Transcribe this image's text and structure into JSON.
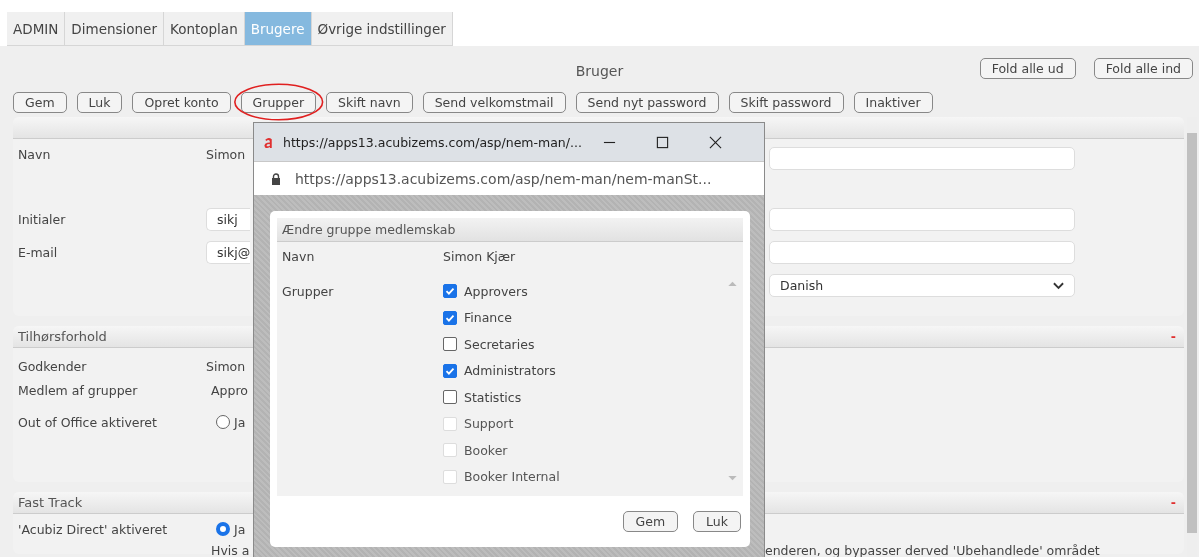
{
  "tabs": [
    {
      "label": "ADMIN",
      "selected": false
    },
    {
      "label": "Dimensioner",
      "selected": false
    },
    {
      "label": "Kontoplan",
      "selected": false
    },
    {
      "label": "Brugere",
      "selected": true
    },
    {
      "label": "Øvrige indstillinger",
      "selected": false
    }
  ],
  "page_title": "Bruger",
  "fold_buttons": [
    "Fold alle ud",
    "Fold alle ind"
  ],
  "toolbar_buttons": [
    {
      "label": "Gem",
      "highlighted": false
    },
    {
      "label": "Luk",
      "highlighted": false
    },
    {
      "label": "Opret konto",
      "highlighted": false
    },
    {
      "label": "Grupper",
      "highlighted": true
    },
    {
      "label": "Skift navn",
      "highlighted": false
    },
    {
      "label": "Send velkomstmail",
      "highlighted": false
    },
    {
      "label": "Send nyt password",
      "highlighted": false
    },
    {
      "label": "Skift password",
      "highlighted": false
    },
    {
      "label": "Inaktiver",
      "highlighted": false
    }
  ],
  "sections": [
    {
      "rows": [
        {
          "label": "Navn",
          "value": {
            "kind": "text",
            "text": "Simon"
          },
          "right": {
            "kind": "input"
          }
        },
        {
          "label": "Initialer",
          "value": {
            "kind": "input",
            "text": "sikj"
          },
          "right": {
            "kind": "input"
          }
        },
        {
          "label": "E-mail",
          "value": {
            "kind": "input",
            "text": "sikj@"
          },
          "right": {
            "kind": "input"
          }
        },
        {
          "right": {
            "kind": "select",
            "text": "Danish"
          }
        }
      ]
    },
    {
      "title": "Tilhørsforhold",
      "collapse": "-",
      "rows": [
        {
          "label": "Godkender",
          "value": {
            "kind": "text",
            "text": "Simon"
          }
        },
        {
          "label": "Medlem af grupper",
          "value": {
            "kind": "text",
            "text": "Appro"
          }
        },
        {
          "label": "Out of Office aktiveret",
          "value": {
            "kind": "radio",
            "text": "Ja",
            "selected": false
          }
        }
      ]
    },
    {
      "title": "Fast Track",
      "collapse": "-",
      "rows": [
        {
          "label": "'Acubiz Direct' aktiveret",
          "value": {
            "kind": "radio",
            "text": "Ja",
            "selected": true
          }
        }
      ],
      "note": [
        "Hvis a",
        "enderen, og bypasser derved 'Ubehandlede' området"
      ]
    }
  ],
  "popup": {
    "title": "https://apps13.acubizems.com/asp/nem-man/...",
    "address": "https://apps13.acubizems.com/asp/nem-man/nem-manSt...",
    "dialog": {
      "title": "Ændre gruppe medlemskab",
      "name_label": "Navn",
      "name_value": "Simon Kjær",
      "groups_label": "Grupper",
      "groups": [
        {
          "label": "Approvers",
          "checked": true,
          "disabled": false
        },
        {
          "label": "Finance",
          "checked": true,
          "disabled": false
        },
        {
          "label": "Secretaries",
          "checked": false,
          "disabled": false
        },
        {
          "label": "Administrators",
          "checked": true,
          "disabled": false
        },
        {
          "label": "Statistics",
          "checked": false,
          "disabled": false
        },
        {
          "label": "Support",
          "checked": false,
          "disabled": true
        },
        {
          "label": "Booker",
          "checked": false,
          "disabled": true
        },
        {
          "label": "Booker Internal",
          "checked": false,
          "disabled": true
        }
      ],
      "buttons": [
        "Gem",
        "Luk"
      ]
    }
  }
}
